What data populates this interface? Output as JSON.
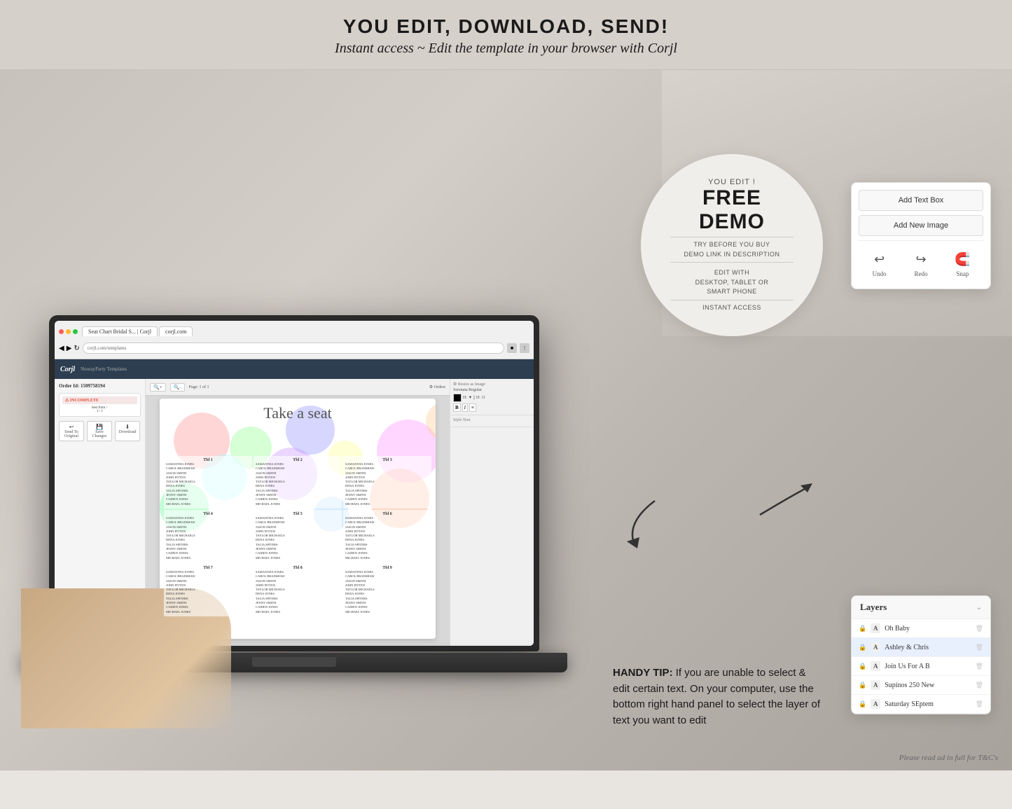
{
  "banner": {
    "headline": "YOU EDIT, DOWNLOAD, SEND!",
    "subline": "Instant access ~ Edit the template in your browser with Corjl"
  },
  "demo_circle": {
    "you_edit": "YOU EDIT !",
    "free": "FREE",
    "demo": "DEMO",
    "try_before": "TRY BEFORE YOU BUY",
    "demo_link": "DEMO LINK IN DESCRIPTION",
    "edit_with": "EDIT WITH",
    "devices": "DESKTOP, TABLET OR",
    "smart_phone": "SMART PHONE",
    "instant": "INSTANT ACCESS"
  },
  "handy_tip": {
    "label": "HANDY TIP:",
    "text": " If you are unable to select & edit certain text. On your computer, use the bottom right hand panel to select the layer of text you want to edit"
  },
  "floating_panel": {
    "add_text_box": "Add Text Box",
    "add_new_image": "Add New Image",
    "undo": "Undo",
    "redo": "Redo",
    "snap": "Snap"
  },
  "layers_panel": {
    "title": "Layers",
    "items": [
      {
        "name": "Oh Baby",
        "type": "A",
        "locked": true
      },
      {
        "name": "Ashley & Chris",
        "type": "A",
        "locked": true,
        "selected": true
      },
      {
        "name": "Join Us For A B",
        "type": "A",
        "locked": true
      },
      {
        "name": "Supinos 250 New",
        "type": "A",
        "locked": true
      },
      {
        "name": "Saturday SEptem",
        "type": "A",
        "locked": true
      }
    ]
  },
  "seating_chart": {
    "title": "Take a seat",
    "tables": [
      {
        "num": "Tbl 1",
        "guests": [
          "SAMANTHA JONES",
          "CAROL BRADSHAW",
          "JASON SMITH",
          "JOHN PITTEN",
          "TAYLOR MICHAELS",
          "DENA JONES",
          "TALIA SPITERS",
          "JENNY SMITH",
          "CAIDEN JONES",
          "MICHAEL JONES"
        ]
      },
      {
        "num": "Tbl 2",
        "guests": [
          "SAMANTHA JONES",
          "CAROL BRADSHAW",
          "JASON SMITH",
          "JOHN PITTEN",
          "TAYLOR MICHAELS",
          "DENA JONES",
          "TALIA SPITERS",
          "JENNY SMITH",
          "CAIDEN JONES",
          "MICHAEL JONES"
        ]
      },
      {
        "num": "Tbl 3",
        "guests": [
          "SAMANTHA JONES",
          "CAROL BRADSHAW",
          "JASON SMITH",
          "JOHN PITTEN",
          "TAYLOR MICHAELS",
          "DENA JONES",
          "TALIA SPITERS",
          "JENNY SMITH",
          "CAIDEN JONES",
          "MICHAEL JONES"
        ]
      },
      {
        "num": "Tbl 4",
        "guests": [
          "SAMANTHA JONES",
          "CAROL BRADSHAW",
          "JASON SMITH",
          "JOHN PITTEN",
          "TAYLOR MICHAELS",
          "DENA JONES",
          "TALIA SPITERS",
          "JENNY SMITH",
          "CAIDEN JONES",
          "MICHAEL JONES"
        ]
      },
      {
        "num": "Tbl 5",
        "guests": [
          "SAMANTHA JONES",
          "CAROL BRADSHAW",
          "JASON SMITH",
          "JOHN PITTEN",
          "TAYLOR MICHAELS",
          "DENA JONES",
          "TALIA SPITERS",
          "JENNY SMITH",
          "CAIDEN JONES",
          "MICHAEL JONES"
        ]
      },
      {
        "num": "Tbl 6",
        "guests": [
          "SAMANTHA JONES",
          "CAROL BRADSHAW",
          "JASON SMITH",
          "JOHN PITTEN",
          "TAYLOR MICHAELS",
          "DENA JONES",
          "TALIA SPITERS",
          "JENNY SMITH",
          "CAIDEN JONES",
          "MICHAEL JONES"
        ]
      },
      {
        "num": "Tbl 7",
        "guests": [
          "SAMANTHA JONES",
          "CAROL BRADSHAW",
          "JASON SMITH",
          "JOHN PITTEN",
          "TAYLOR MICHAELS",
          "DENA JONES",
          "TALIA SPITERS",
          "JENNY SMITH",
          "CAIDEN JONES",
          "MICHAEL JONES"
        ]
      },
      {
        "num": "Tbl 8",
        "guests": [
          "SAMANTHA JONES",
          "CAROL BRADSHAW",
          "JASON SMITH",
          "JOHN PITTEN",
          "TAYLOR MICHAELS",
          "DENA JONES",
          "TALIA SPITERS",
          "JENNY SMITH",
          "CAIDEN JONES",
          "MICHAEL JONES"
        ]
      },
      {
        "num": "Tbl 9",
        "guests": [
          "SAMANTHA JONES",
          "CAROL BRADSHAW",
          "JASON SMITH",
          "JOHN PITTEN",
          "TAYLOR MICHAELS",
          "DENA JONES",
          "TALIA SPITERS",
          "JENNY SMITH",
          "CAIDEN JONES",
          "MICHAEL JONES"
        ]
      }
    ]
  },
  "browser": {
    "url": "corjl.com/templates",
    "tab1": "Seat Chart Bridal S... | Corjl",
    "tab2": "corjl.com"
  },
  "tc_text": "Please read ad in full for T&C's"
}
